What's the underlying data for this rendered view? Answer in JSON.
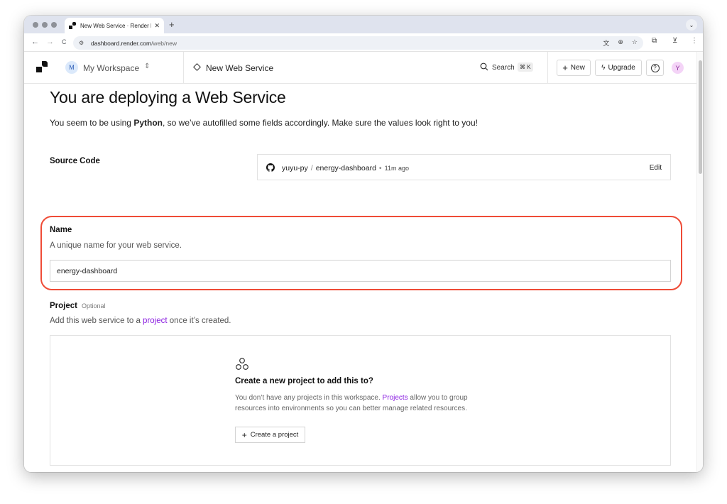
{
  "browser": {
    "tab_title": "New Web Service · Render D",
    "tab_close": "✕",
    "new_tab": "+",
    "address_host": "dashboard.render.com",
    "address_path": "/web/new",
    "back": "←",
    "forward": "→",
    "reload": "C"
  },
  "header": {
    "workspace_initial": "M",
    "workspace_name": "My Workspace",
    "workspace_chevron": "⌃",
    "page_name": "New Web Service",
    "search_label": "Search",
    "search_shortcut": "⌘ K",
    "new_label": "New",
    "upgrade_label": "Upgrade",
    "help_label": "?",
    "user_initial": "Y"
  },
  "main": {
    "title": "You are deploying a Web Service",
    "subtitle_prefix": "You seem to be using ",
    "subtitle_lang": "Python",
    "subtitle_suffix": ", so we’ve autofilled some fields accordingly. Make sure the values look right to you!",
    "source": {
      "label": "Source Code",
      "repo_owner": "yuyu-py",
      "repo_sep": "/",
      "repo_name": "energy-dashboard",
      "dot": "•",
      "time": "11m ago",
      "edit_label": "Edit"
    },
    "name": {
      "label": "Name",
      "description": "A unique name for your web service.",
      "value": "energy-dashboard"
    },
    "project": {
      "label": "Project",
      "optional": "Optional",
      "desc_prefix": "Add this web service to a ",
      "desc_link": "project",
      "desc_suffix": " once it’s created.",
      "empty_title": "Create a new project to add this to?",
      "empty_text_prefix": "You don’t have any projects in this workspace. ",
      "empty_text_link": "Projects",
      "empty_text_suffix": " allow you to group resources into environments so you can better manage related resources.",
      "create_label": "Create a project"
    }
  },
  "colors": {
    "link": "#8a1ee0",
    "highlight": "#ef4b36"
  }
}
